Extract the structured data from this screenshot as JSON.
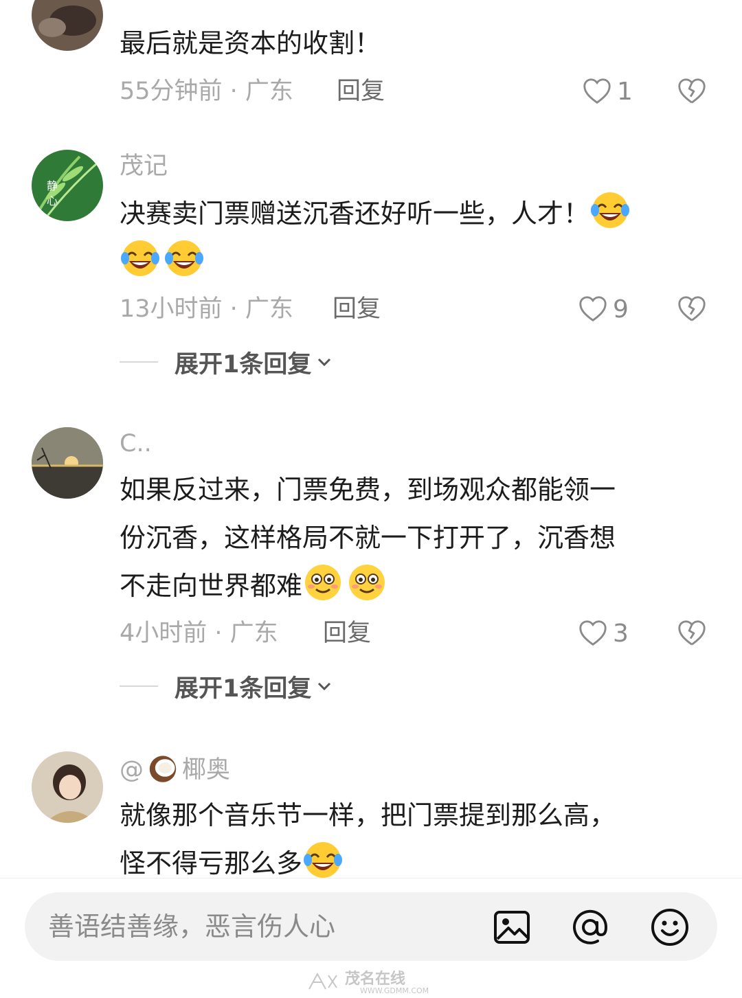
{
  "comments": [
    {
      "username": "",
      "lines": [
        "最后就是资本的收割！"
      ],
      "time_location": "55分钟前 · 广东",
      "reply_label": "回复",
      "like_count": "1"
    },
    {
      "username": "茂记",
      "lines": [
        "决赛卖门票赠送沉香还好听一些，人才！"
      ],
      "emoji": "face-with-tears-of-joy",
      "time_location": "13小时前 · 广东",
      "reply_label": "回复",
      "like_count": "9",
      "expand_label": "展开1条回复"
    },
    {
      "username": "C..",
      "lines": [
        "如果反过来，门票免费，到场观众都能领一",
        "份沉香，这样格局不就一下打开了，沉香想",
        "不走向世界都难"
      ],
      "emoji": "smiling-face",
      "time_location": "4小时前 · 广东",
      "reply_label": "回复",
      "like_count": "3",
      "expand_label": "展开1条回复"
    },
    {
      "username_prefix": "@",
      "username": "椰奥",
      "username_emoji": "coconut",
      "lines": [
        "就像那个音乐节一样，把门票提到那么高，",
        "怪不得亏那么多"
      ],
      "emoji": "face-with-tears-of-joy"
    }
  ],
  "input": {
    "placeholder": "善语结善缘，恶言伤人心"
  },
  "watermark": {
    "name": "茂名在线",
    "url": "WWW.GDMM.COM"
  }
}
